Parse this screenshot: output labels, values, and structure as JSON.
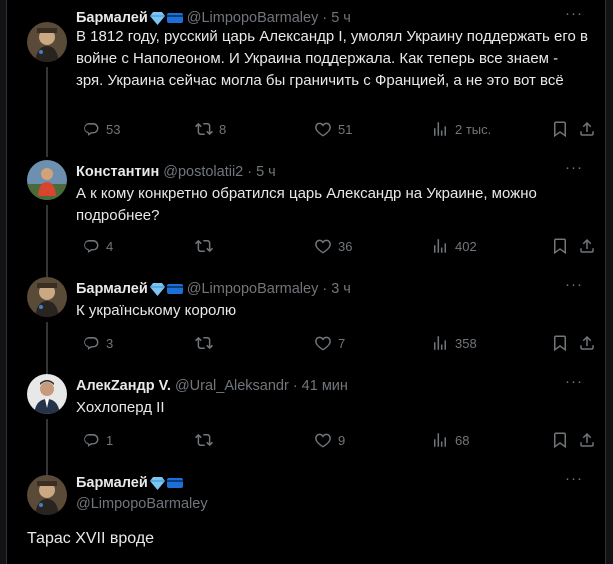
{
  "tweets": [
    {
      "name": "Бармалей",
      "handle": "@LimpopoBarmaley",
      "time": "5 ч",
      "text": "В 1812 году, русский царь Александр I, умолял Украину поддержать его в войне с Наполеоном. И Украина поддержала. Как теперь все знаем - зря. Украина сейчас могла бы граничить с Францией, а не это вот всё",
      "replies": "53",
      "reposts": "8",
      "likes": "51",
      "views": "2 тыс."
    },
    {
      "name": "Константин",
      "handle": "@postolatii2",
      "time": "5 ч",
      "text": "А к кому конкретно обратился царь Александр на Украине, можно подробнее?",
      "replies": "4",
      "reposts": "",
      "likes": "36",
      "views": "402"
    },
    {
      "name": "Бармалей",
      "handle": "@LimpopoBarmaley",
      "time": "3 ч",
      "text": "К украïнському королю",
      "replies": "3",
      "reposts": "",
      "likes": "7",
      "views": "358"
    },
    {
      "name": "АлекZандр V.",
      "handle": "@Ural_Aleksandr",
      "time": "41 мин",
      "text": "Хохлоперд II",
      "replies": "1",
      "reposts": "",
      "likes": "9",
      "views": "68"
    }
  ],
  "main_tweet": {
    "name": "Бармалей",
    "handle": "@LimpopoBarmaley",
    "text": "Тарас XVII  вроде"
  },
  "colors": {
    "background": "#000000",
    "muted": "#71767b",
    "text": "#e7e9ea",
    "divider": "#2f3336"
  }
}
